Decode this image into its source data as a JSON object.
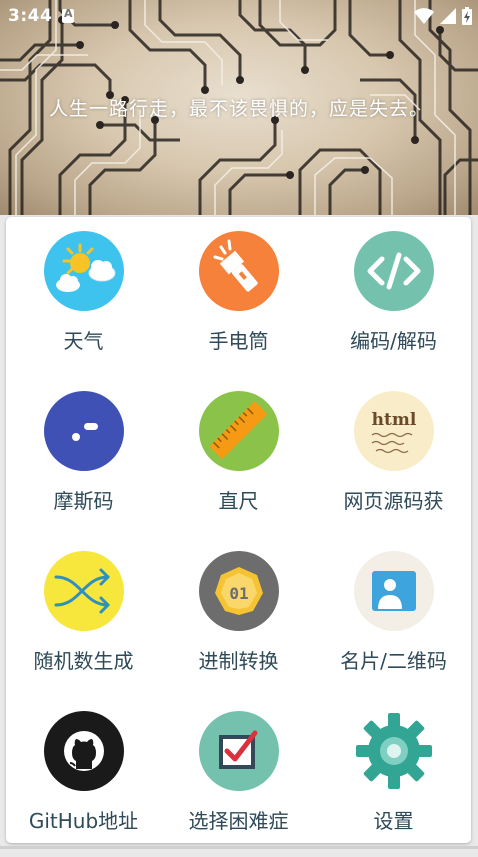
{
  "status": {
    "time": "3:44"
  },
  "header": {
    "quote": "人生一路行走，最不该畏惧的，应是失去。"
  },
  "grid": {
    "items": [
      {
        "label": "天气",
        "icon": "weather-icon",
        "color": "#3ec3ef"
      },
      {
        "label": "手电筒",
        "icon": "flashlight-icon",
        "color": "#f5813a"
      },
      {
        "label": "编码/解码",
        "icon": "code-icon",
        "color": "#74c2ae"
      },
      {
        "label": "摩斯码",
        "icon": "morse-icon",
        "color": "#3f51b5"
      },
      {
        "label": "直尺",
        "icon": "ruler-icon",
        "color": "#8bc34a"
      },
      {
        "label": "网页源码获",
        "icon": "html-icon",
        "color": "#f9ecc8"
      },
      {
        "label": "随机数生成",
        "icon": "shuffle-icon",
        "color": "#f7e63c"
      },
      {
        "label": "进制转换",
        "icon": "binary-icon",
        "color": "#6d6d6d"
      },
      {
        "label": "名片/二维码",
        "icon": "card-icon",
        "color": "#f3eee6"
      },
      {
        "label": "GitHub地址",
        "icon": "github-icon",
        "color": "#1a1a1a"
      },
      {
        "label": "选择困难症",
        "icon": "checkbox-icon",
        "color": "#74c2ae"
      },
      {
        "label": "设置",
        "icon": "gear-icon",
        "color": "#33a595"
      }
    ]
  }
}
